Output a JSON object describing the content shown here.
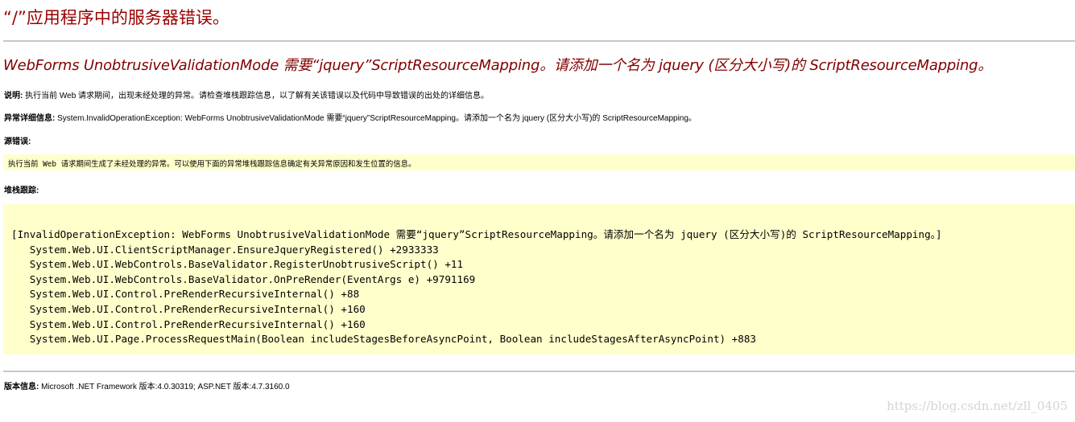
{
  "page": {
    "title": "“/”应用程序中的服务器错误。",
    "error_heading": "WebForms UnobtrusiveValidationMode 需要“jquery”ScriptResourceMapping。请添加一个名为 jquery (区分大小写)的 ScriptResourceMapping。",
    "description": {
      "label": "说明:",
      "text": "执行当前 Web 请求期间，出现未经处理的异常。请检查堆栈跟踪信息，以了解有关该错误以及代码中导致错误的出处的详细信息。"
    },
    "exception_details": {
      "label": "异常详细信息:",
      "text": "System.InvalidOperationException: WebForms UnobtrusiveValidationMode 需要“jquery”ScriptResourceMapping。请添加一个名为 jquery (区分大小写)的 ScriptResourceMapping。"
    },
    "source_error": {
      "label": "源错误:",
      "text": "执行当前 Web 请求期间生成了未经处理的异常。可以使用下面的异常堆栈跟踪信息确定有关异常原因和发生位置的信息。"
    },
    "stack_trace": {
      "label": "堆栈跟踪:",
      "lines": [
        "[InvalidOperationException: WebForms UnobtrusiveValidationMode 需要“jquery”ScriptResourceMapping。请添加一个名为 jquery (区分大小写)的 ScriptResourceMapping。]",
        "   System.Web.UI.ClientScriptManager.EnsureJqueryRegistered() +2933333",
        "   System.Web.UI.WebControls.BaseValidator.RegisterUnobtrusiveScript() +11",
        "   System.Web.UI.WebControls.BaseValidator.OnPreRender(EventArgs e) +9791169",
        "   System.Web.UI.Control.PreRenderRecursiveInternal() +88",
        "   System.Web.UI.Control.PreRenderRecursiveInternal() +160",
        "   System.Web.UI.Control.PreRenderRecursiveInternal() +160",
        "   System.Web.UI.Page.ProcessRequestMain(Boolean includeStagesBeforeAsyncPoint, Boolean includeStagesAfterAsyncPoint) +883"
      ]
    },
    "version_info": {
      "label": "版本信息:",
      "text": "Microsoft .NET Framework 版本:4.0.30319; ASP.NET 版本:4.7.3160.0"
    },
    "watermark": "https://blog.csdn.net/zll_0405"
  },
  "colors": {
    "title": "#990000",
    "heading": "#800000",
    "code_background": "#ffffcc",
    "rule": "#c8c8c8"
  }
}
